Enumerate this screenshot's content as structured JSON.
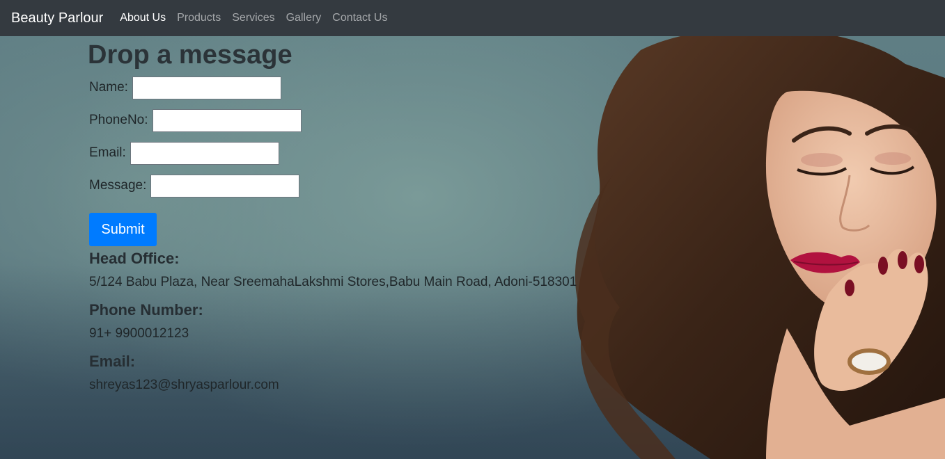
{
  "navbar": {
    "brand": "Beauty Parlour",
    "links": [
      {
        "label": "About Us",
        "active": true
      },
      {
        "label": "Products",
        "active": false
      },
      {
        "label": "Services",
        "active": false
      },
      {
        "label": "Gallery",
        "active": false
      },
      {
        "label": "Contact Us",
        "active": false
      }
    ]
  },
  "form": {
    "title": "Drop a message",
    "fields": {
      "name": {
        "label": "Name:",
        "value": ""
      },
      "phone": {
        "label": "PhoneNo:",
        "value": ""
      },
      "email": {
        "label": "Email:",
        "value": ""
      },
      "message": {
        "label": "Message:",
        "value": ""
      }
    },
    "submit_label": "Submit"
  },
  "contact": {
    "head_office": {
      "heading": "Head Office:",
      "text": "5/124 Babu Plaza, Near SreemahaLakshmi Stores,Babu Main Road, Adoni-518301"
    },
    "phone": {
      "heading": "Phone Number:",
      "text": "91+ 9900012123"
    },
    "email": {
      "heading": "Email:",
      "text": "shreyas123@shryasparlour.com"
    }
  },
  "colors": {
    "navbar_bg": "#343a40",
    "accent_button": "#007bff"
  }
}
